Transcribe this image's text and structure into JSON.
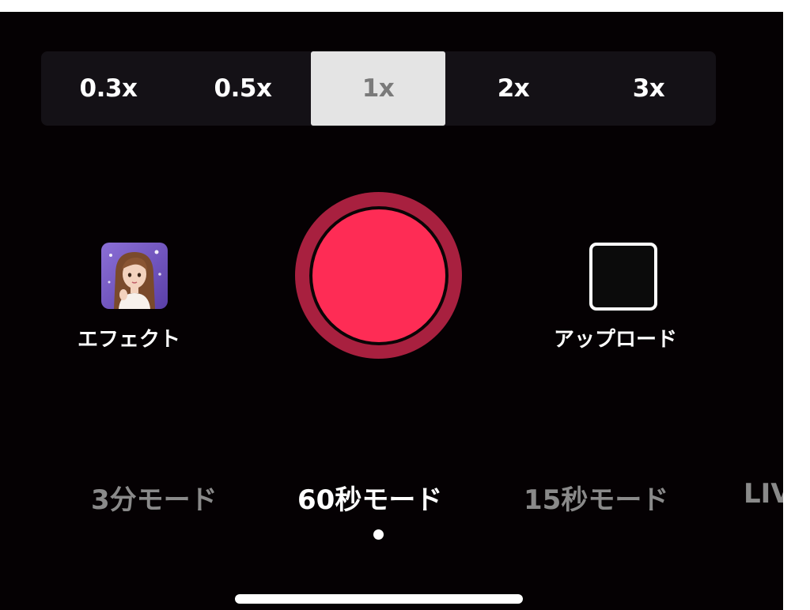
{
  "zoom": {
    "options": [
      "0.3x",
      "0.5x",
      "1x",
      "2x",
      "3x"
    ],
    "selected": "1x"
  },
  "effect": {
    "label": "エフェクト",
    "thumbnail_icon": "avatar-girl-icon"
  },
  "record": {
    "icon": "record-button-icon",
    "color": "#fe2c55"
  },
  "upload": {
    "label": "アップロード",
    "icon": "gallery-thumbnail-icon"
  },
  "modes": {
    "items": [
      "3分モード",
      "60秒モード",
      "15秒モード",
      "LIV"
    ],
    "active": "60秒モード"
  },
  "colors": {
    "background": "#050103",
    "record_red": "#fe2c55",
    "record_ring": "#a8203f",
    "zoom_selected_bg": "#e4e4e4"
  }
}
